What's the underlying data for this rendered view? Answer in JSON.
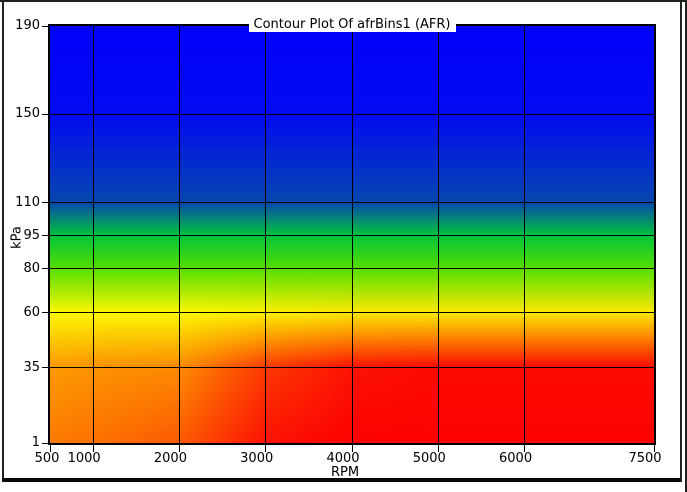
{
  "window": {
    "background": "#ffffff",
    "frame_color": "#1d221d",
    "panel_rule_color": "#070707"
  },
  "chart_data": {
    "type": "heatmap",
    "title": "Contour Plot Of afrBins1 (AFR)",
    "xlabel": "RPM",
    "ylabel": "kPa",
    "x_range": [
      500,
      7500
    ],
    "y_range": [
      1,
      190
    ],
    "x_bins": [
      500,
      1000,
      2000,
      3000,
      4000,
      5000,
      6000,
      7500
    ],
    "y_bins": [
      190,
      150,
      110,
      95,
      80,
      60,
      35,
      1
    ],
    "x_tick_labels": [
      "500",
      "1000",
      "2000",
      "3000",
      "4000",
      "5000",
      "6000",
      "7500"
    ],
    "y_tick_labels": [
      "190",
      "150",
      "110",
      "95",
      "80",
      "60",
      "35",
      "1"
    ],
    "grid": true,
    "gridline_color": "#000000",
    "frame_color": "#000000",
    "interpolation": "bilinear",
    "cell_colors": [
      [
        "#0202fa",
        "#0202fa",
        "#0202fa",
        "#0202fa",
        "#0202fa",
        "#0202fa",
        "#0202fa",
        "#0202fa"
      ],
      [
        "#020af2",
        "#020af2",
        "#020af2",
        "#020af2",
        "#020af2",
        "#020af2",
        "#020af2",
        "#020af2"
      ],
      [
        "#0648ae",
        "#0648ae",
        "#0648ae",
        "#0648ae",
        "#0648ae",
        "#0648ae",
        "#0648ae",
        "#0648ae"
      ],
      [
        "#04c43c",
        "#04c43c",
        "#04c43c",
        "#04c43c",
        "#04c43c",
        "#04c43c",
        "#04c43c",
        "#04c43c"
      ],
      [
        "#55e002",
        "#55e002",
        "#55e002",
        "#55e002",
        "#55e002",
        "#55e002",
        "#55e002",
        "#55e002"
      ],
      [
        "#fcf702",
        "#fcf702",
        "#fcf702",
        "#fcf002",
        "#fce802",
        "#fce802",
        "#fce802",
        "#fce802"
      ],
      [
        "#fc9a02",
        "#fc9202",
        "#fc8a02",
        "#fc3a02",
        "#fc1202",
        "#fc0a02",
        "#fc0a02",
        "#fc0a02"
      ],
      [
        "#fc7a02",
        "#fc7202",
        "#fc5a02",
        "#fc1202",
        "#fc0202",
        "#fc0202",
        "#fc0202",
        "#fc0202"
      ]
    ]
  }
}
